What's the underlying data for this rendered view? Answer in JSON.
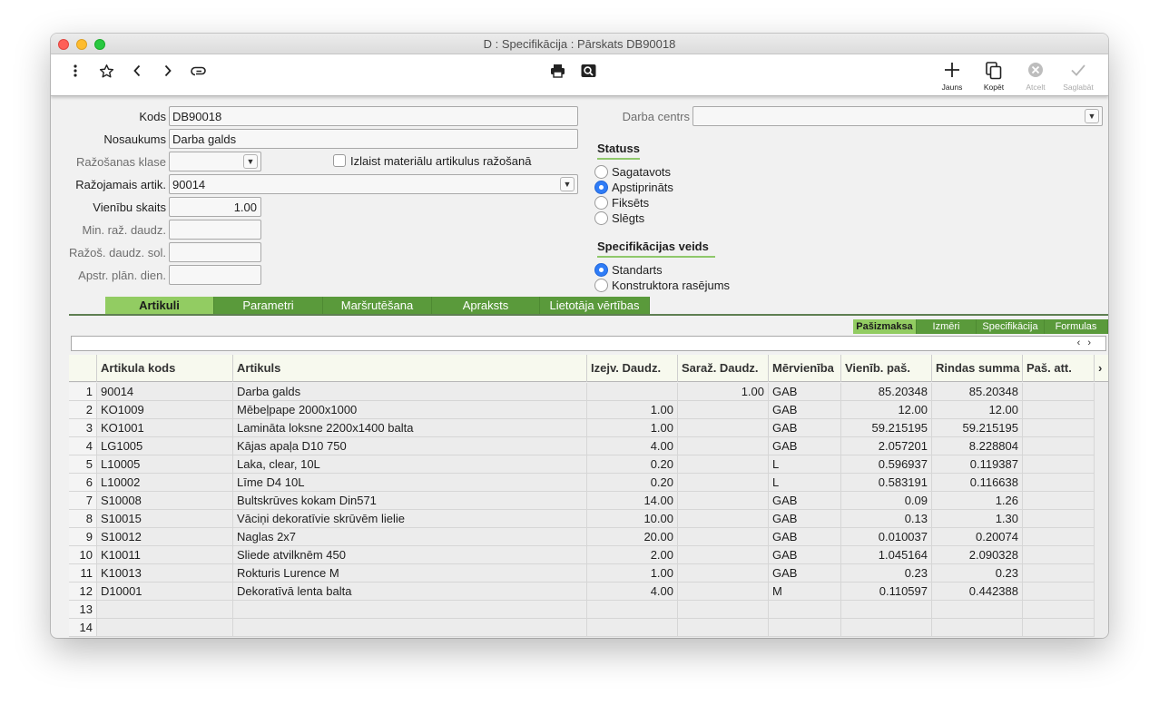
{
  "window": {
    "title": "D : Specifikācija : Pārskats DB90018"
  },
  "toolbar": {
    "icons": [
      "more-vertical-icon",
      "star-icon",
      "back-icon",
      "forward-icon",
      "attach-icon",
      "print-icon",
      "search-icon"
    ],
    "new_label": "Jauns",
    "copy_label": "Kopēt",
    "cancel_label": "Atcelt",
    "save_label": "Saglabāt"
  },
  "form": {
    "kods_label": "Kods",
    "kods_value": "DB90018",
    "nosaukums_label": "Nosaukums",
    "nosaukums_value": "Darba galds",
    "razosanas_klase_label": "Ražošanas klase",
    "razosanas_klase_value": "",
    "izlaist_label": "Izlaist materiālu artikulus ražošanā",
    "razojamais_label": "Ražojamais artik.",
    "razojamais_value": "90014",
    "vienibu_label": "Vienību skaits",
    "vienibu_value": "1.00",
    "min_raz_label": "Min. raž. daudz.",
    "min_raz_value": "",
    "razos_sol_label": "Ražoš. daudz. sol.",
    "razos_sol_value": "",
    "apstr_label": "Apstr. plān. dien.",
    "apstr_value": "",
    "darba_centrs_label": "Darba centrs",
    "darba_centrs_value": ""
  },
  "statuss": {
    "title": "Statuss",
    "options": [
      "Sagatavots",
      "Apstiprināts",
      "Fiksēts",
      "Slēgts"
    ],
    "selected": "Apstiprināts"
  },
  "spec_veids": {
    "title": "Specifikācijas veids",
    "options": [
      "Standarts",
      "Konstruktora rasējums"
    ],
    "selected": "Standarts"
  },
  "tabs": [
    "Artikuli",
    "Parametri",
    "Maršrutēšana",
    "Apraksts",
    "Lietotāja vērtības"
  ],
  "active_tab": "Artikuli",
  "subtabs": [
    "Pašizmaksa",
    "Izmēri",
    "Specifikācija",
    "Formulas"
  ],
  "active_subtab": "Pašizmaksa",
  "colors": {
    "tab_green": "#5a9a3b",
    "tab_active": "#92cc62",
    "radio_blue": "#2f7cf6"
  },
  "grid": {
    "headers": [
      "Artikula kods",
      "Artikuls",
      "Izejv. Daudz.",
      "Saraž. Daudz.",
      "Mērvienība",
      "Vienīb. paš.",
      "Rindas summa",
      "Paš. att."
    ],
    "more_arrow": "›",
    "rows": [
      {
        "n": "1",
        "kods": "90014",
        "artikuls": "Darba galds",
        "izejv": "",
        "saraz": "1.00",
        "mv": "GAB",
        "vien": "85.20348",
        "summa": "85.20348",
        "att": ""
      },
      {
        "n": "2",
        "kods": "KO1009",
        "artikuls": "Mēbeļpape 2000x1000",
        "izejv": "1.00",
        "saraz": "",
        "mv": "GAB",
        "vien": "12.00",
        "summa": "12.00",
        "att": ""
      },
      {
        "n": "3",
        "kods": "KO1001",
        "artikuls": "Lamināta loksne 2200x1400 balta",
        "izejv": "1.00",
        "saraz": "",
        "mv": "GAB",
        "vien": "59.215195",
        "summa": "59.215195",
        "att": ""
      },
      {
        "n": "4",
        "kods": "LG1005",
        "artikuls": "Kājas apaļa D10 750",
        "izejv": "4.00",
        "saraz": "",
        "mv": "GAB",
        "vien": "2.057201",
        "summa": "8.228804",
        "att": ""
      },
      {
        "n": "5",
        "kods": "L10005",
        "artikuls": "Laka, clear, 10L",
        "izejv": "0.20",
        "saraz": "",
        "mv": "L",
        "vien": "0.596937",
        "summa": "0.119387",
        "att": ""
      },
      {
        "n": "6",
        "kods": "L10002",
        "artikuls": "Līme D4 10L",
        "izejv": "0.20",
        "saraz": "",
        "mv": "L",
        "vien": "0.583191",
        "summa": "0.116638",
        "att": ""
      },
      {
        "n": "7",
        "kods": "S10008",
        "artikuls": "Bultskrūves kokam Din571",
        "izejv": "14.00",
        "saraz": "",
        "mv": "GAB",
        "vien": "0.09",
        "summa": "1.26",
        "att": ""
      },
      {
        "n": "8",
        "kods": "S10015",
        "artikuls": "Vāciņi dekoratīvie skrūvēm lielie",
        "izejv": "10.00",
        "saraz": "",
        "mv": "GAB",
        "vien": "0.13",
        "summa": "1.30",
        "att": ""
      },
      {
        "n": "9",
        "kods": "S10012",
        "artikuls": "Naglas 2x7",
        "izejv": "20.00",
        "saraz": "",
        "mv": "GAB",
        "vien": "0.010037",
        "summa": "0.20074",
        "att": ""
      },
      {
        "n": "10",
        "kods": "K10011",
        "artikuls": "Sliede atvilknēm 450",
        "izejv": "2.00",
        "saraz": "",
        "mv": "GAB",
        "vien": "1.045164",
        "summa": "2.090328",
        "att": ""
      },
      {
        "n": "11",
        "kods": "K10013",
        "artikuls": "Rokturis Lurence M",
        "izejv": "1.00",
        "saraz": "",
        "mv": "GAB",
        "vien": "0.23",
        "summa": "0.23",
        "att": ""
      },
      {
        "n": "12",
        "kods": "D10001",
        "artikuls": "Dekoratīvā lenta balta",
        "izejv": "4.00",
        "saraz": "",
        "mv": "M",
        "vien": "0.110597",
        "summa": "0.442388",
        "att": ""
      },
      {
        "n": "13",
        "kods": "",
        "artikuls": "",
        "izejv": "",
        "saraz": "",
        "mv": "",
        "vien": "",
        "summa": "",
        "att": ""
      },
      {
        "n": "14",
        "kods": "",
        "artikuls": "",
        "izejv": "",
        "saraz": "",
        "mv": "",
        "vien": "",
        "summa": "",
        "att": ""
      }
    ]
  }
}
